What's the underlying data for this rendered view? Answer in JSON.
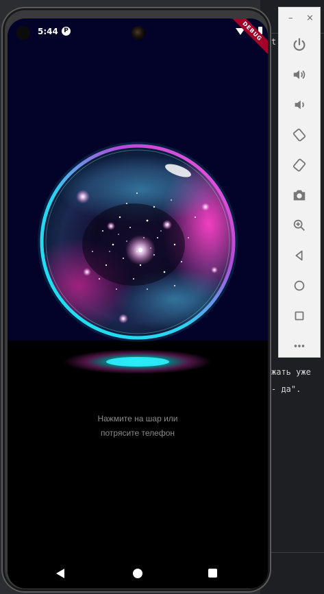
{
  "status_bar": {
    "time": "5:44",
    "debug_label": "DEBUG"
  },
  "hint": {
    "line1": "Нажмите на шар или",
    "line2": "потрясите телефон"
  },
  "emulator_toolbar": {
    "window_controls": {
      "minimize": "–",
      "close": "×"
    },
    "buttons": [
      "power-icon",
      "volume-up-icon",
      "volume-down-icon",
      "rotate-left-icon",
      "rotate-right-icon",
      "camera-icon",
      "zoom-icon",
      "back-icon",
      "home-icon",
      "overview-icon",
      "more-icon"
    ]
  },
  "ide_background": {
    "top_fragment": "t",
    "code_line_1": "жать уже",
    "code_line_2": "- да\"."
  },
  "colors": {
    "screen_background": "#03032a",
    "orb_cyan": "#1fe3f0",
    "orb_magenta": "#e23ab8",
    "hint_text": "#8a8a8a"
  }
}
